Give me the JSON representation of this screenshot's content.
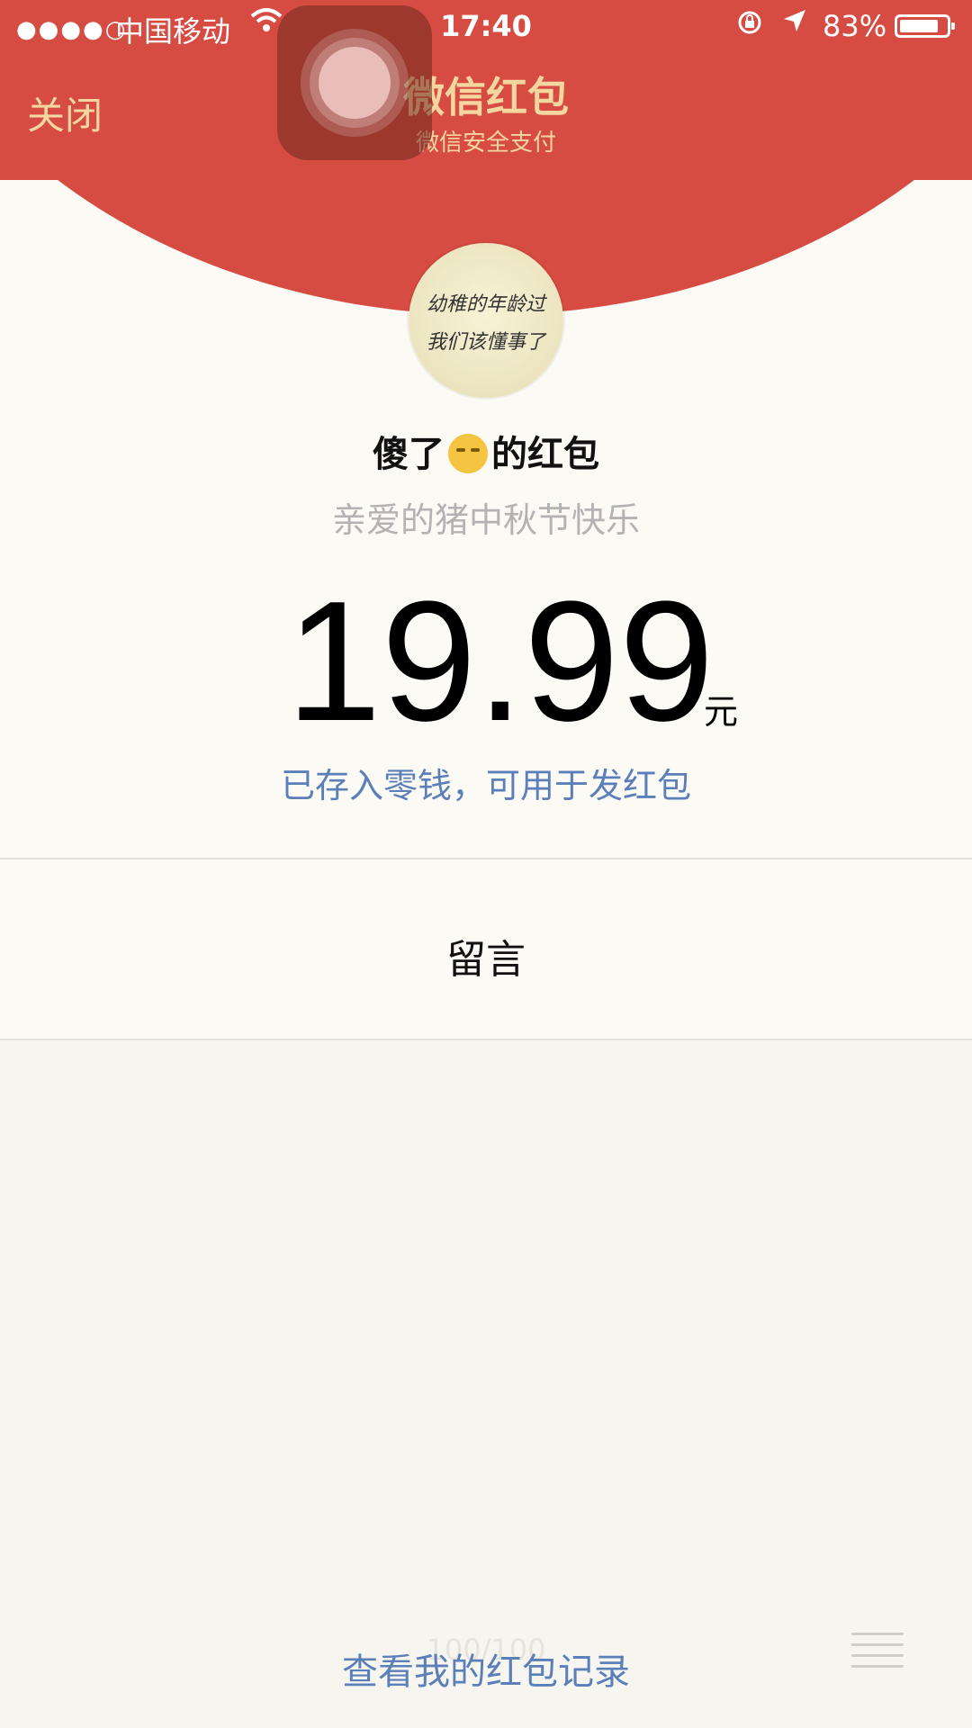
{
  "status_bar": {
    "signal_icon": "signal-dots",
    "carrier": "中国移动",
    "wifi_icon": "wifi-icon",
    "time": "17:40",
    "lock_icon": "rotation-lock-icon",
    "location_icon": "location-arrow-icon",
    "battery_percent": "83%",
    "battery_level": 0.83
  },
  "nav": {
    "close_label": "关闭",
    "title": "微信红包",
    "subtitle": "微信安全支付"
  },
  "assistive_touch_icon": "assistive-touch-icon",
  "avatar": {
    "text_line1": "幼稚的年龄过",
    "text_line2": "我们该懂事了"
  },
  "sender": {
    "name": "傻了",
    "emoji": "pensive-face-emoji",
    "suffix": "的红包"
  },
  "wish": "亲爱的猪中秋节快乐",
  "amount": "19.99",
  "currency": "元",
  "deposit_link": "已存入零钱，可用于发红包",
  "leave_message": "留言",
  "scroll_indicator": "100/100",
  "records_link": "查看我的红包记录",
  "menu_icon": "list-menu-icon",
  "colors": {
    "header_red": "#d64c43",
    "gold_text": "#f3d6a0",
    "link_blue": "#5b7fb8",
    "panel_bg": "#fcfaf5",
    "page_bg": "#f7f5f0"
  }
}
